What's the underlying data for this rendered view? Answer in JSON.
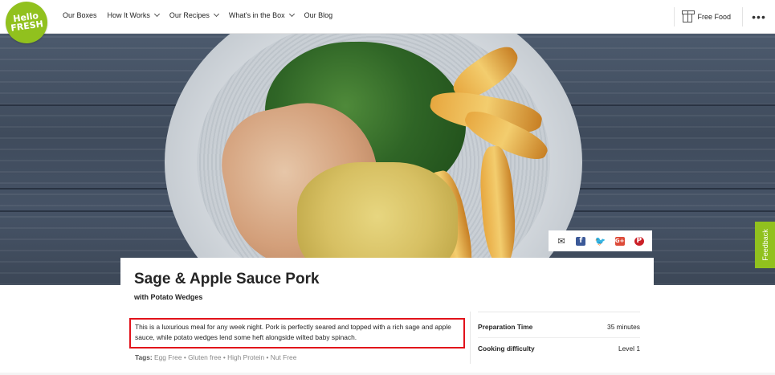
{
  "logo": {
    "line1": "Hello",
    "line2": "FRESH"
  },
  "nav": [
    {
      "label": "Our Boxes",
      "dropdown": false
    },
    {
      "label": "How It Works",
      "dropdown": true
    },
    {
      "label": "Our Recipes",
      "dropdown": true
    },
    {
      "label": "What's in the Box",
      "dropdown": true
    },
    {
      "label": "Our Blog",
      "dropdown": false
    }
  ],
  "header": {
    "free_food": "Free Food",
    "more": "•••"
  },
  "social": {
    "mail_icon": "✉",
    "facebook_icon": "f",
    "twitter_icon": "🐦",
    "google_plus_icon": "G+",
    "pinterest_icon": "P"
  },
  "feedback": "Feedback",
  "recipe": {
    "title": "Sage & Apple Sauce Pork",
    "subtitle": "with Potato Wedges",
    "description": "This is a luxurious meal for any week night. Pork is perfectly seared and topped with a rich sage and apple sauce, while potato wedges lend some heft alongside wilted baby spinach.",
    "tags_label": "Tags:",
    "tags": "Egg Free • Gluten free • High Protein • Nut Free",
    "prep_label": "Preparation Time",
    "prep_value": "35 minutes",
    "difficulty_label": "Cooking difficulty",
    "difficulty_value": "Level 1"
  },
  "colors": {
    "brand": "#91c11e",
    "highlight_border": "#e2121b"
  }
}
